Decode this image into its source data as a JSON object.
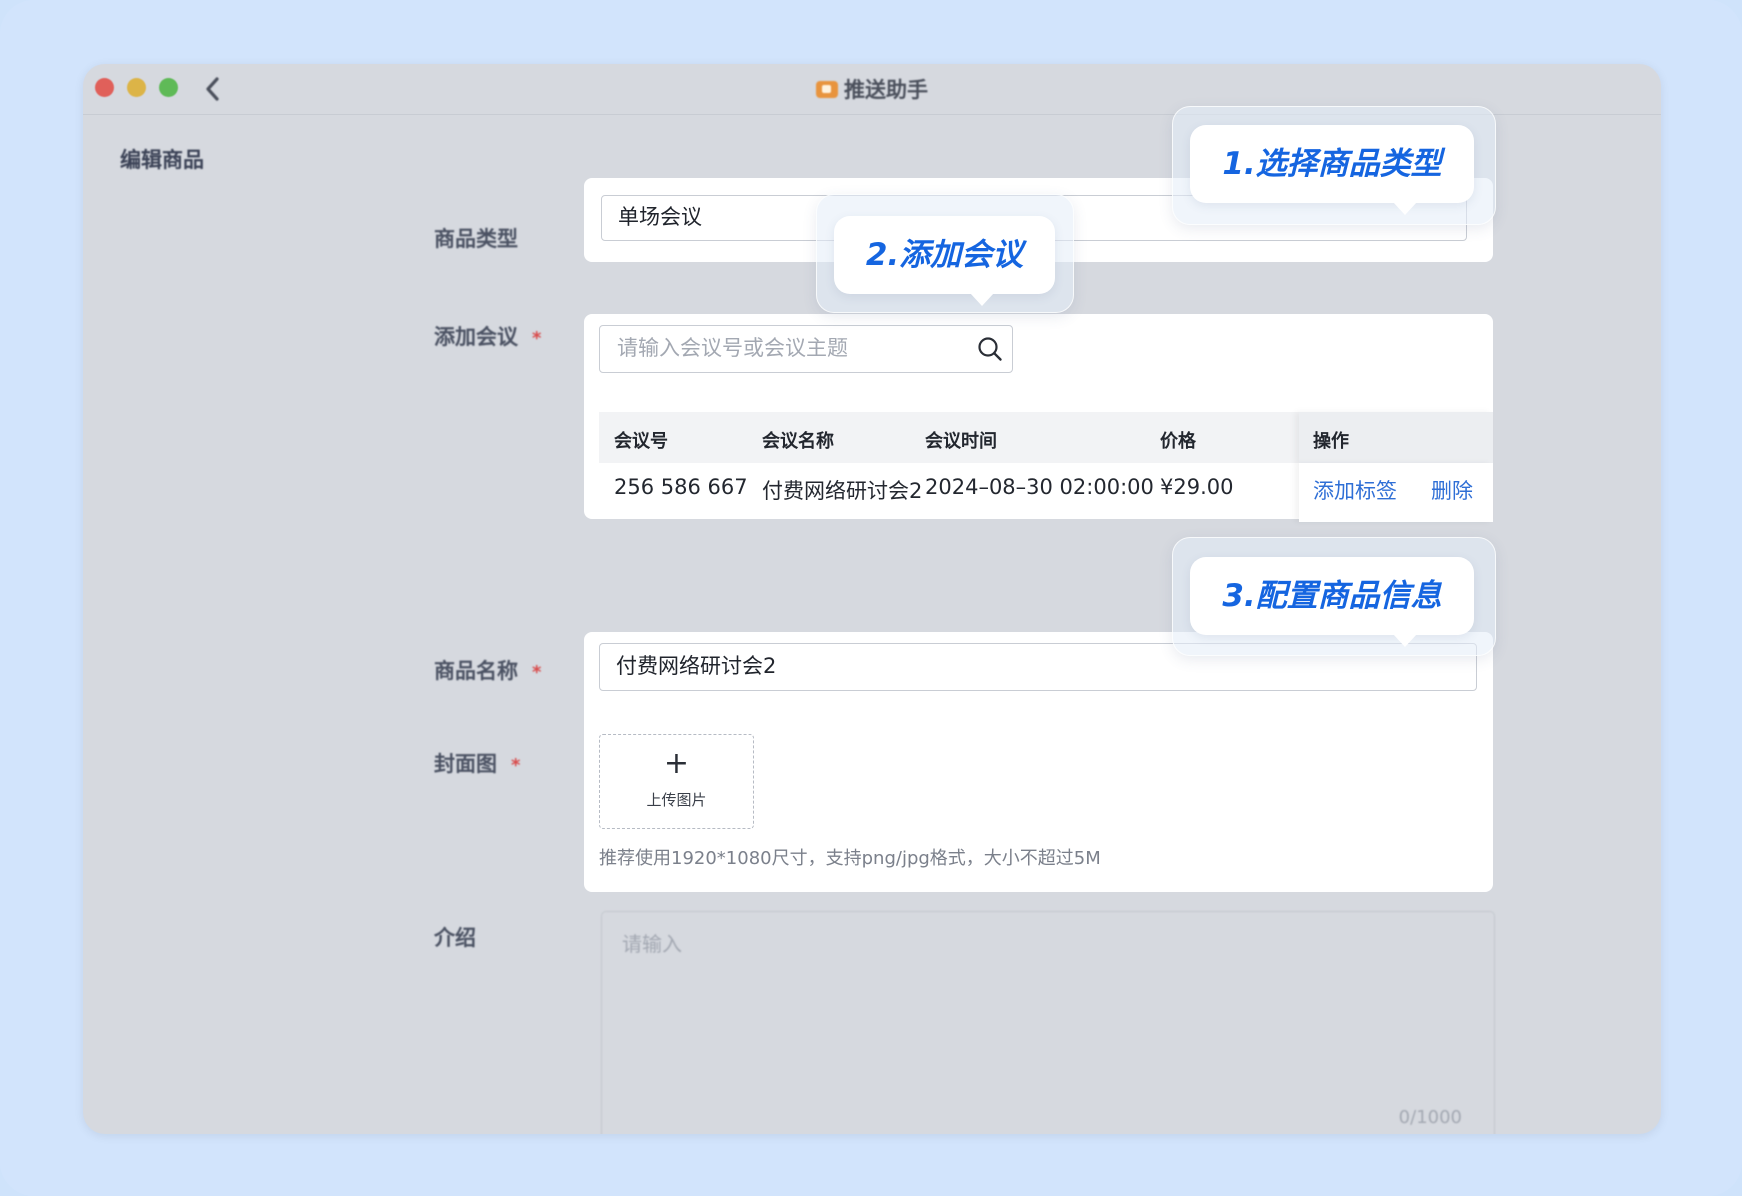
{
  "app": {
    "title": "推送助手"
  },
  "page": {
    "heading": "编辑商品"
  },
  "form": {
    "product_type": {
      "label": "商品类型",
      "value": "单场会议"
    },
    "add_meeting": {
      "label": "添加会议",
      "required_mark": "*",
      "search_placeholder": "请输入会议号或会议主题",
      "table": {
        "headers": [
          "会议号",
          "会议名称",
          "会议时间",
          "价格",
          "操作"
        ],
        "rows": [
          {
            "meeting_id": "256 586 667",
            "meeting_name": "付费网络研讨会2",
            "meeting_time": "2024–08–30 02:00:00",
            "price": "¥29.00",
            "actions": [
              "添加标签",
              "删除"
            ]
          }
        ]
      }
    },
    "product_name": {
      "label": "商品名称",
      "required_mark": "*",
      "value": "付费网络研讨会2"
    },
    "cover": {
      "label": "封面图",
      "required_mark": "*",
      "upload_label": "上传图片",
      "upload_icon": "+",
      "hint": "推荐使用1920*1080尺寸，支持png/jpg格式，大小不超过5M"
    },
    "intro": {
      "label": "介绍",
      "placeholder": "请输入",
      "counter": "0/1000"
    }
  },
  "callouts": {
    "step1": "1.选择商品类型",
    "step2": "2.添加会议",
    "step3": "3.配置商品信息"
  },
  "colors": {
    "background": "#d2e4fc",
    "window": "#d6d9df",
    "accent": "#1565e0",
    "link": "#2f6fd6",
    "required": "#d94b4b"
  }
}
